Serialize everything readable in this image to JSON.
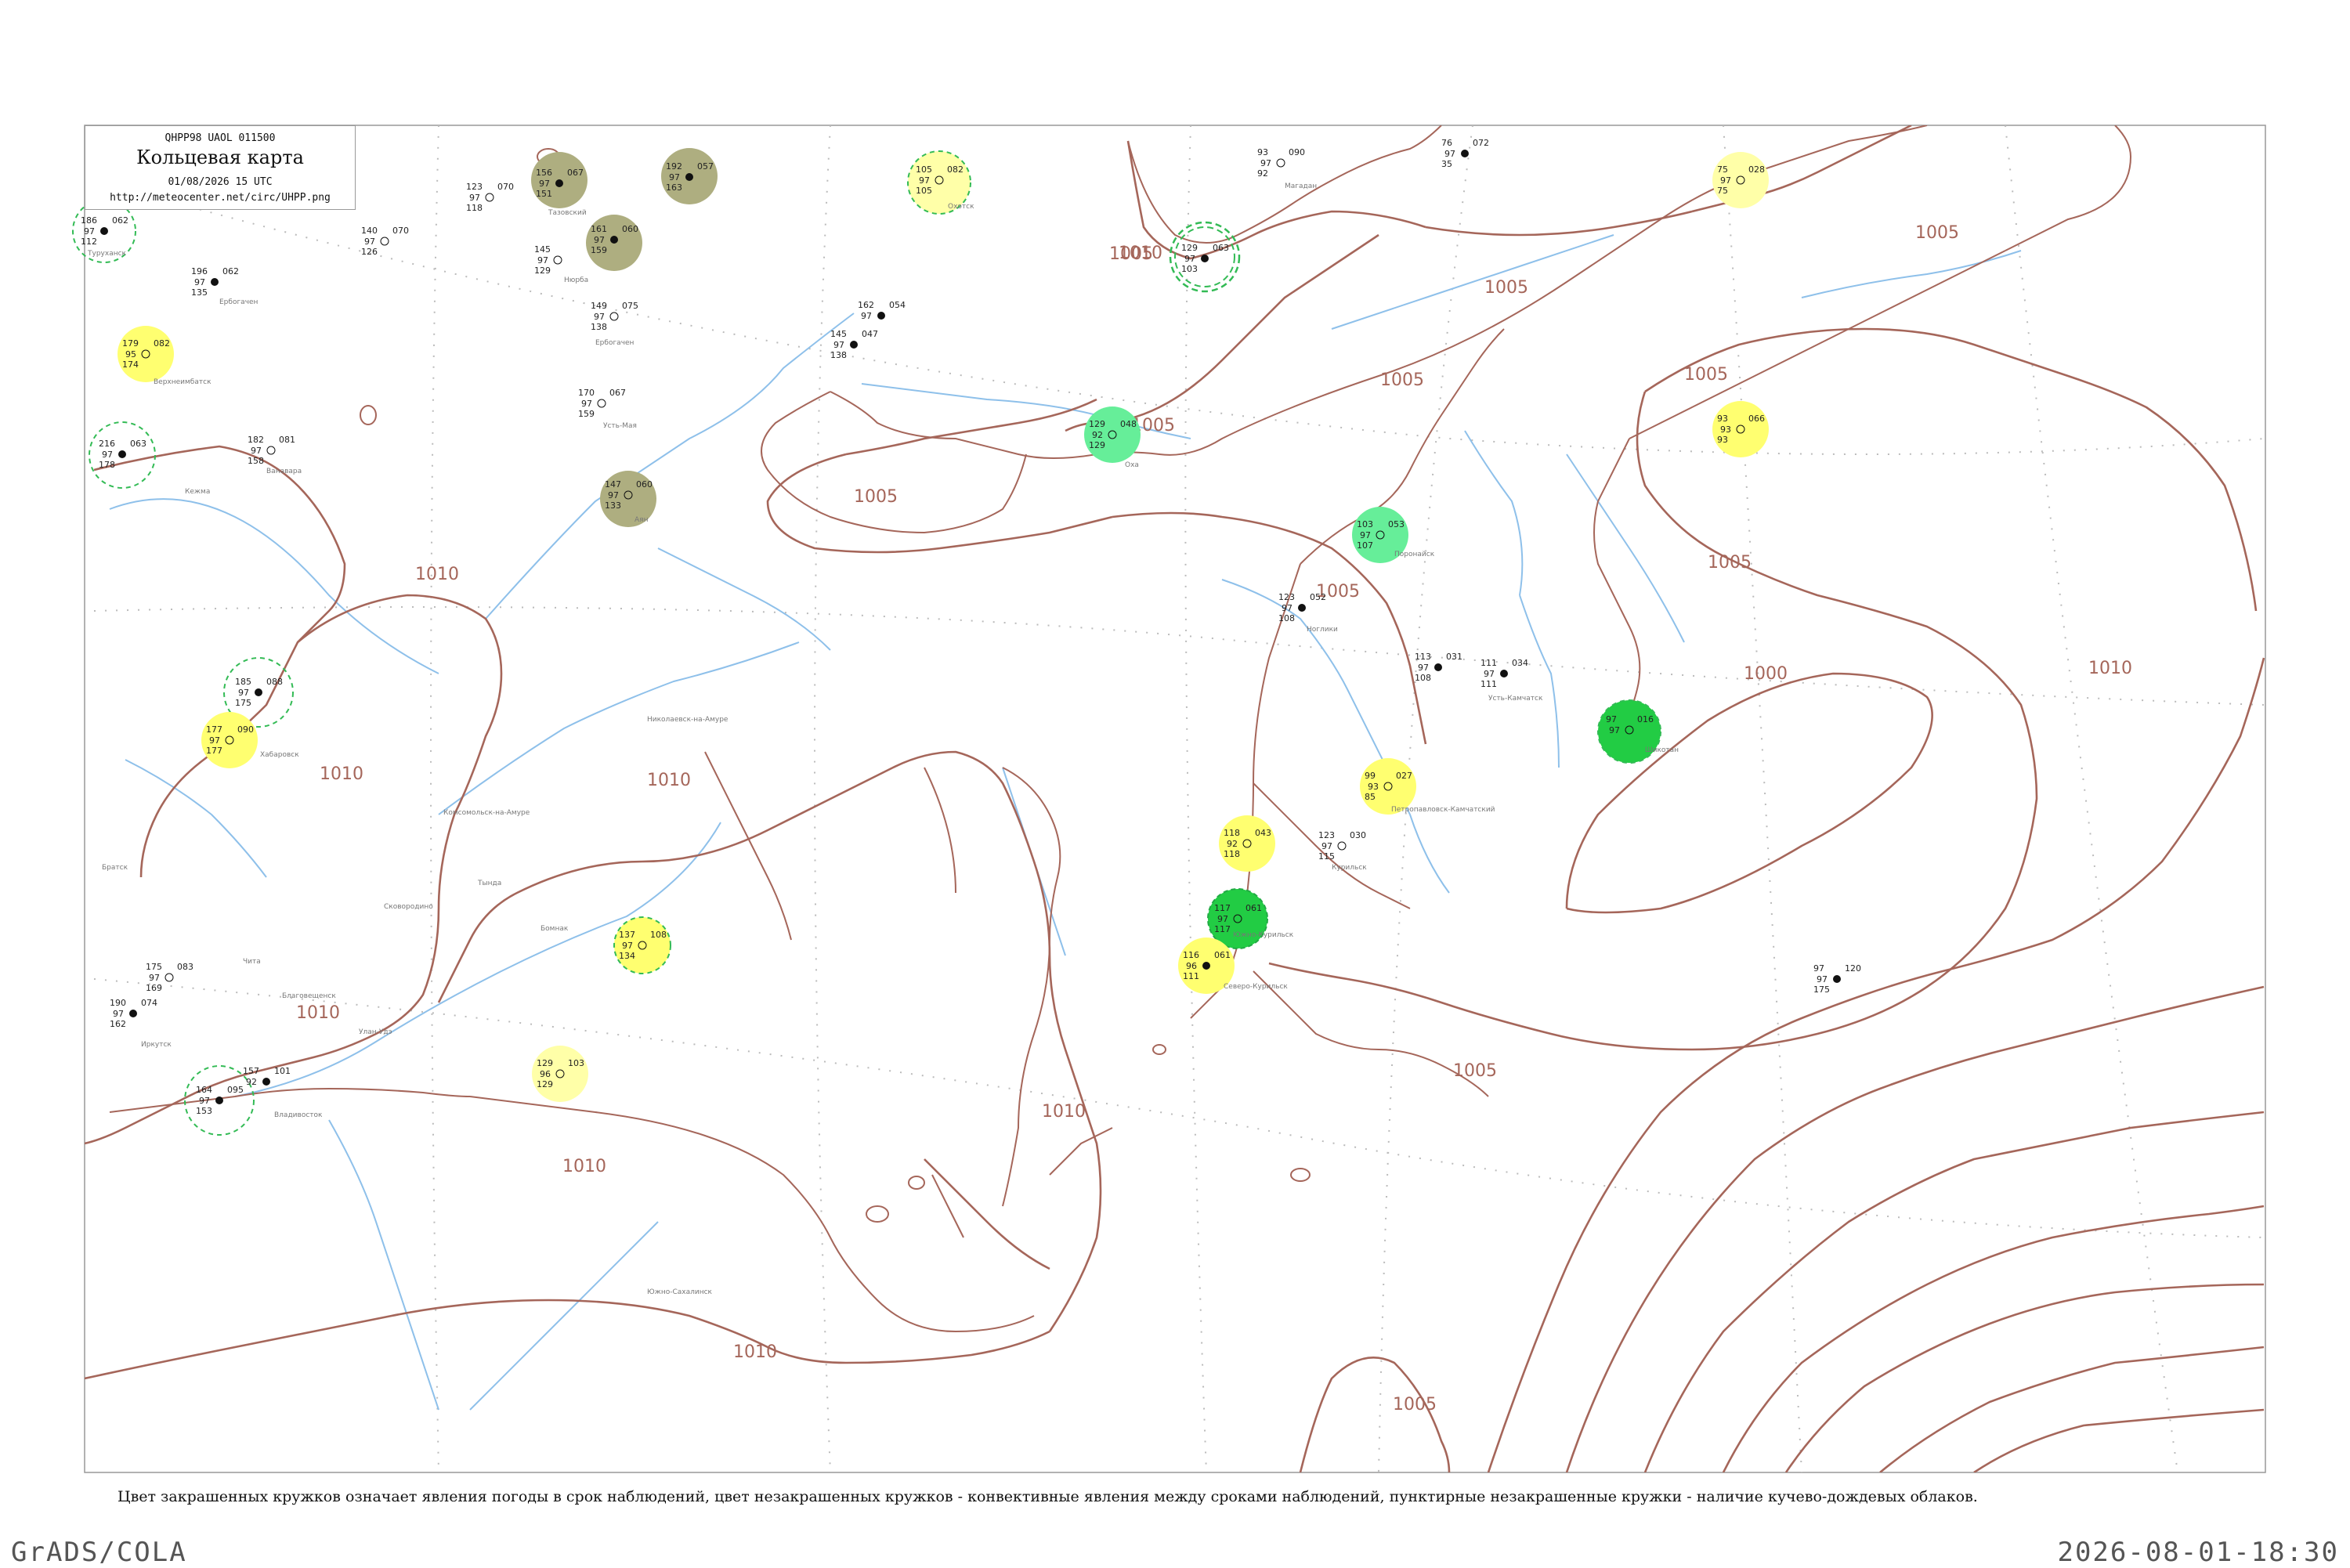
{
  "header": {
    "code": "QHPP98  UAOL  011500",
    "title": "Кольцевая карта",
    "datetime": "01/08/2026 15 UTC",
    "url": "http://meteocenter.net/circ/UHPP.png"
  },
  "caption": "Цвет закрашенных кружков означает явления погоды в срок наблюдений, цвет незакрашенных кружков - конвективные явления между сроками наблюдений, пунктирные незакрашенные кружки - наличие кучево-дождевых облаков.",
  "footer": {
    "left": "GrADS/COLA",
    "right": "2026-08-01-18:30"
  },
  "colors": {
    "isobar": "#a5665a",
    "coast": "#a5665a",
    "river": "#7fb6e8",
    "graticule": "#b8b8b8",
    "olive": "#aeae80",
    "yellow": "#ffff70",
    "light_yellow": "#ffffa8",
    "mint": "#66ee99",
    "green": "#22cc44",
    "dash_green": "#33bb55"
  },
  "isobar_labels": [
    {
      "text": "1005"
    },
    {
      "text": "1005"
    },
    {
      "text": "1005"
    },
    {
      "text": "1005"
    },
    {
      "text": "1005"
    },
    {
      "text": "1005"
    },
    {
      "text": "1005"
    },
    {
      "text": "1005"
    },
    {
      "text": "1005"
    },
    {
      "text": "1005"
    },
    {
      "text": "1010"
    },
    {
      "text": "1010"
    },
    {
      "text": "1010"
    },
    {
      "text": "1010"
    },
    {
      "text": "1010"
    },
    {
      "text": "1010"
    },
    {
      "text": "1010"
    },
    {
      "text": "1010"
    },
    {
      "text": "1000"
    },
    {
      "text": "1010"
    }
  ],
  "stations": [
    {
      "name": "Туруханск",
      "id": "23472",
      "t": "186",
      "p": "062",
      "td": "112",
      "v": "97",
      "c": "",
      "circle": "dash"
    },
    {
      "name": "",
      "id": "",
      "t": "123",
      "p": "070",
      "td": "118",
      "v": "97",
      "c": "",
      "circle": ""
    },
    {
      "name": "Тазовский",
      "id": "",
      "t": "156",
      "p": "067",
      "td": "151",
      "v": "97",
      "c": "",
      "circle": "olive"
    },
    {
      "name": "",
      "id": "24471",
      "t": "192",
      "p": "057",
      "td": "163",
      "v": "97",
      "c": "",
      "circle": "olive"
    },
    {
      "name": "",
      "id": "24959",
      "t": "161",
      "p": "060",
      "td": "159",
      "v": "97",
      "c": "",
      "circle": "olive"
    },
    {
      "name": "",
      "id": "",
      "t": "105",
      "p": "082",
      "td": "105",
      "v": "97",
      "c": "",
      "circle": "lyellow-dash"
    },
    {
      "name": "",
      "id": "",
      "t": "140",
      "p": "070",
      "td": "126",
      "v": "97",
      "c": "",
      "circle": ""
    },
    {
      "name": "Нюрба",
      "id": "",
      "t": "145",
      "p": "",
      "td": "129",
      "v": "97",
      "c": "",
      "circle": ""
    },
    {
      "name": "",
      "id": "",
      "t": "196",
      "p": "062",
      "td": "135",
      "v": "97",
      "c": "",
      "circle": ""
    },
    {
      "name": "",
      "id": "",
      "t": "179",
      "p": "082",
      "td": "174",
      "v": "95",
      "c": "",
      "circle": "yellow"
    },
    {
      "name": "",
      "id": "",
      "t": "149",
      "p": "075",
      "td": "138",
      "v": "97",
      "c": "",
      "circle": ""
    },
    {
      "name": "",
      "id": "",
      "t": "216",
      "p": "063",
      "td": "178",
      "v": "97",
      "c": "",
      "circle": "dash"
    },
    {
      "name": "",
      "id": "",
      "t": "182",
      "p": "081",
      "td": "158",
      "v": "97",
      "c": "",
      "circle": ""
    },
    {
      "name": "",
      "id": "",
      "t": "170",
      "p": "067",
      "td": "159",
      "v": "97",
      "c": "",
      "circle": ""
    },
    {
      "name": "",
      "id": "",
      "t": "147",
      "p": "060",
      "td": "133",
      "v": "97",
      "c": "",
      "circle": "olive"
    },
    {
      "name": "",
      "id": "",
      "t": "162",
      "p": "054",
      "td": "",
      "v": "97",
      "c": "",
      "circle": ""
    },
    {
      "name": "",
      "id": "",
      "t": "145",
      "p": "047",
      "td": "138",
      "v": "97",
      "c": "",
      "circle": ""
    },
    {
      "name": "",
      "id": "",
      "t": "129",
      "p": "063",
      "td": "103",
      "v": "97",
      "c": "",
      "circle": "dash2"
    },
    {
      "name": "",
      "id": "",
      "t": "93",
      "p": "090",
      "td": "92",
      "v": "97",
      "c": "",
      "circle": ""
    },
    {
      "name": "",
      "id": "",
      "t": "76",
      "p": "072",
      "td": "35",
      "v": "97",
      "c": "",
      "circle": ""
    },
    {
      "name": "",
      "id": "",
      "t": "75",
      "p": "028",
      "td": "75",
      "v": "97",
      "c": "",
      "circle": "lyellow"
    },
    {
      "name": "",
      "id": "",
      "t": "129",
      "p": "048",
      "td": "129",
      "v": "92",
      "c": "",
      "circle": "mint"
    },
    {
      "name": "",
      "id": "",
      "t": "93",
      "p": "066",
      "td": "93",
      "v": "93",
      "c": "",
      "circle": "yellow"
    },
    {
      "name": "",
      "id": "",
      "t": "103",
      "p": "053",
      "td": "107",
      "v": "97",
      "c": "",
      "circle": "mint"
    },
    {
      "name": "",
      "id": "",
      "t": "123",
      "p": "052",
      "td": "108",
      "v": "97",
      "c": "",
      "circle": ""
    },
    {
      "name": "",
      "id": "",
      "t": "113",
      "p": "031",
      "td": "108",
      "v": "97",
      "c": "",
      "circle": ""
    },
    {
      "name": "",
      "id": "",
      "t": "111",
      "p": "034",
      "td": "111",
      "v": "97",
      "c": "",
      "circle": ""
    },
    {
      "name": "",
      "id": "",
      "t": "97",
      "p": "016",
      "td": "",
      "v": "97",
      "c": "",
      "circle": "green"
    },
    {
      "name": "",
      "id": "",
      "t": "99",
      "p": "027",
      "td": "85",
      "v": "93",
      "c": "",
      "circle": "yellow"
    },
    {
      "name": "",
      "id": "",
      "t": "118",
      "p": "043",
      "td": "118",
      "v": "92",
      "c": "",
      "circle": "yellow"
    },
    {
      "name": "",
      "id": "",
      "t": "123",
      "p": "030",
      "td": "115",
      "v": "97",
      "c": "",
      "circle": ""
    },
    {
      "name": "",
      "id": "",
      "t": "117",
      "p": "061",
      "td": "117",
      "v": "97",
      "c": "",
      "circle": "green"
    },
    {
      "name": "",
      "id": "",
      "t": "116",
      "p": "061",
      "td": "111",
      "v": "96",
      "c": "",
      "circle": "yellow"
    },
    {
      "name": "",
      "id": "",
      "t": "97",
      "p": "120",
      "td": "175",
      "v": "97",
      "c": "",
      "circle": ""
    },
    {
      "name": "",
      "id": "",
      "t": "185",
      "p": "088",
      "td": "175",
      "v": "97",
      "c": "",
      "circle": "dash"
    },
    {
      "name": "",
      "id": "",
      "t": "177",
      "p": "090",
      "td": "177",
      "v": "97",
      "c": "",
      "circle": "yellow"
    },
    {
      "name": "",
      "id": "",
      "t": "137",
      "p": "108",
      "td": "134",
      "v": "97",
      "c": "",
      "circle": "yellow-dash"
    },
    {
      "name": "",
      "id": "",
      "t": "129",
      "p": "103",
      "td": "129",
      "v": "96",
      "c": "",
      "circle": "lyellow"
    },
    {
      "name": "",
      "id": "",
      "t": "164",
      "p": "095",
      "td": "153",
      "v": "97",
      "c": "",
      "circle": "dash"
    },
    {
      "name": "",
      "id": "",
      "t": "157",
      "p": "101",
      "td": "",
      "v": "92",
      "c": "",
      "circle": ""
    },
    {
      "name": "",
      "id": "",
      "t": "190",
      "p": "074",
      "td": "162",
      "v": "97",
      "c": "",
      "circle": ""
    },
    {
      "name": "",
      "id": "",
      "t": "175",
      "p": "083",
      "td": "169",
      "v": "97",
      "c": "",
      "circle": ""
    }
  ],
  "small_labels": [
    "Туруханск",
    "Тазовский",
    "Нюрба",
    "Ербогачен",
    "Верхнеимбатск",
    "Кежма",
    "Ванавара",
    "Ербогачен",
    "Усть-Мая",
    "Охотск",
    "Аян",
    "Николаевск-на-Амуре",
    "Комсомольск-на-Амуре",
    "Хабаровск",
    "Владивосток",
    "Южно-Сахалинск",
    "Оха",
    "Ноглики",
    "Поронайск",
    "Усть-Камчатск",
    "Петропавловск-Камчатский",
    "Магадан",
    "Северо-Курильск",
    "Курильск",
    "Южно-Курильск",
    "Шикотан",
    "Благовещенск",
    "Тында",
    "Братск",
    "Иркутск",
    "Чита",
    "Улан-Удэ",
    "Сковородино",
    "Бомнак"
  ]
}
